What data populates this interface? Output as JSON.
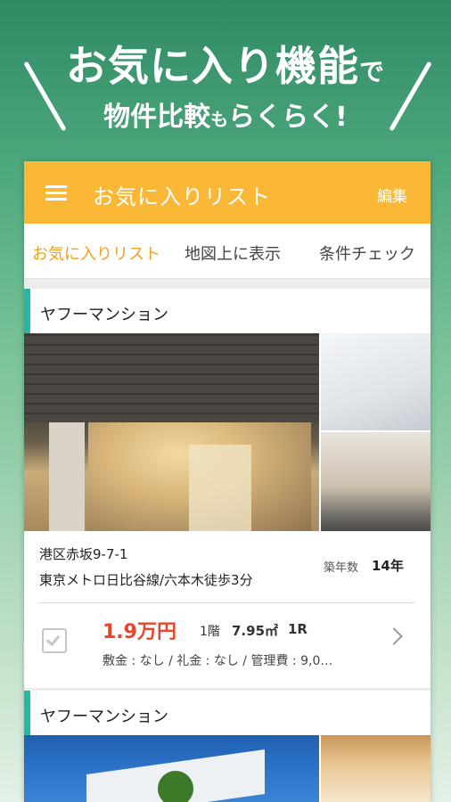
{
  "promo": {
    "line1_main": "お気に入り機能",
    "line1_small": "で",
    "line2_main": "物件比較",
    "line2_small": "も",
    "line2_end": "らくらく!"
  },
  "appbar": {
    "title": "お気に入りリスト",
    "edit_label": "編集"
  },
  "tabs": [
    {
      "label": "お気に入りリスト",
      "active": true
    },
    {
      "label": "地図上に表示",
      "active": false
    },
    {
      "label": "条件チェック",
      "active": false
    }
  ],
  "listings": [
    {
      "name": "ヤフーマンション",
      "address": "港区赤坂9-7-1",
      "station": "東京メトロ日比谷線/六本木徒歩3分",
      "age_label": "築年数",
      "age_value": "14年",
      "price": "1.9万円",
      "floor": "1階",
      "area": "7.95㎡",
      "layout": "1R",
      "fees": "敷金 : なし / 礼金 : なし / 管理費 : 9,0…"
    },
    {
      "name": "ヤフーマンション"
    }
  ],
  "colors": {
    "appbar": "#fbb736",
    "accent_bar": "#24b8a8",
    "price": "#e8452a",
    "active_tab": "#f0a020"
  }
}
